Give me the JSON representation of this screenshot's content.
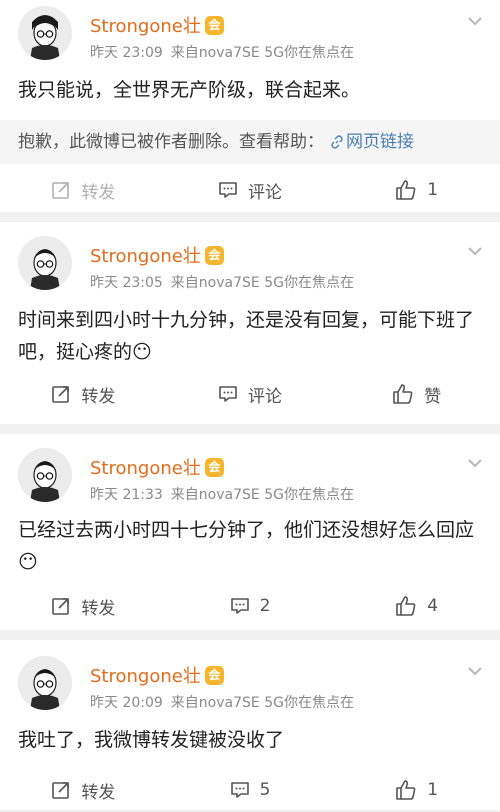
{
  "posts": [
    {
      "author": "Strongone壮",
      "vip_badge": "会",
      "time": "昨天 23:09",
      "source": "来自nova7SE 5G你在焦点在",
      "text": "我只能说，全世界无产阶级，联合起来。",
      "deleted_notice": "抱歉，此微博已被作者删除。查看帮助：",
      "deleted_link": "网页链接",
      "repost_label": "转发",
      "comment_label": "评论",
      "like_label": "1"
    },
    {
      "author": "Strongone壮",
      "vip_badge": "会",
      "time": "昨天 23:05",
      "source": "来自nova7SE 5G你在焦点在",
      "text": "时间来到四小时十九分钟，还是没有回复，可能下班了吧，挺心疼的😶",
      "repost_label": "转发",
      "comment_label": "评论",
      "like_label": "赞"
    },
    {
      "author": "Strongone壮",
      "vip_badge": "会",
      "time": "昨天 21:33",
      "source": "来自nova7SE 5G你在焦点在",
      "text": "已经过去两小时四十七分钟了，他们还没想好怎么回应😶",
      "repost_label": "转发",
      "comment_label": "2",
      "like_label": "4"
    },
    {
      "author": "Strongone壮",
      "vip_badge": "会",
      "time": "昨天 20:09",
      "source": "来自nova7SE 5G你在焦点在",
      "text": "我吐了，我微博转发键被没收了",
      "repost_label": "转发",
      "comment_label": "5",
      "like_label": "1"
    }
  ],
  "colors": {
    "author": "#e46c1a",
    "link": "#4a7fb3",
    "meta": "#8a8a8a"
  },
  "icons": {
    "repost": "repost-icon",
    "comment": "comment-icon",
    "like": "thumbs-up-icon",
    "menu": "chevron-down-icon"
  }
}
